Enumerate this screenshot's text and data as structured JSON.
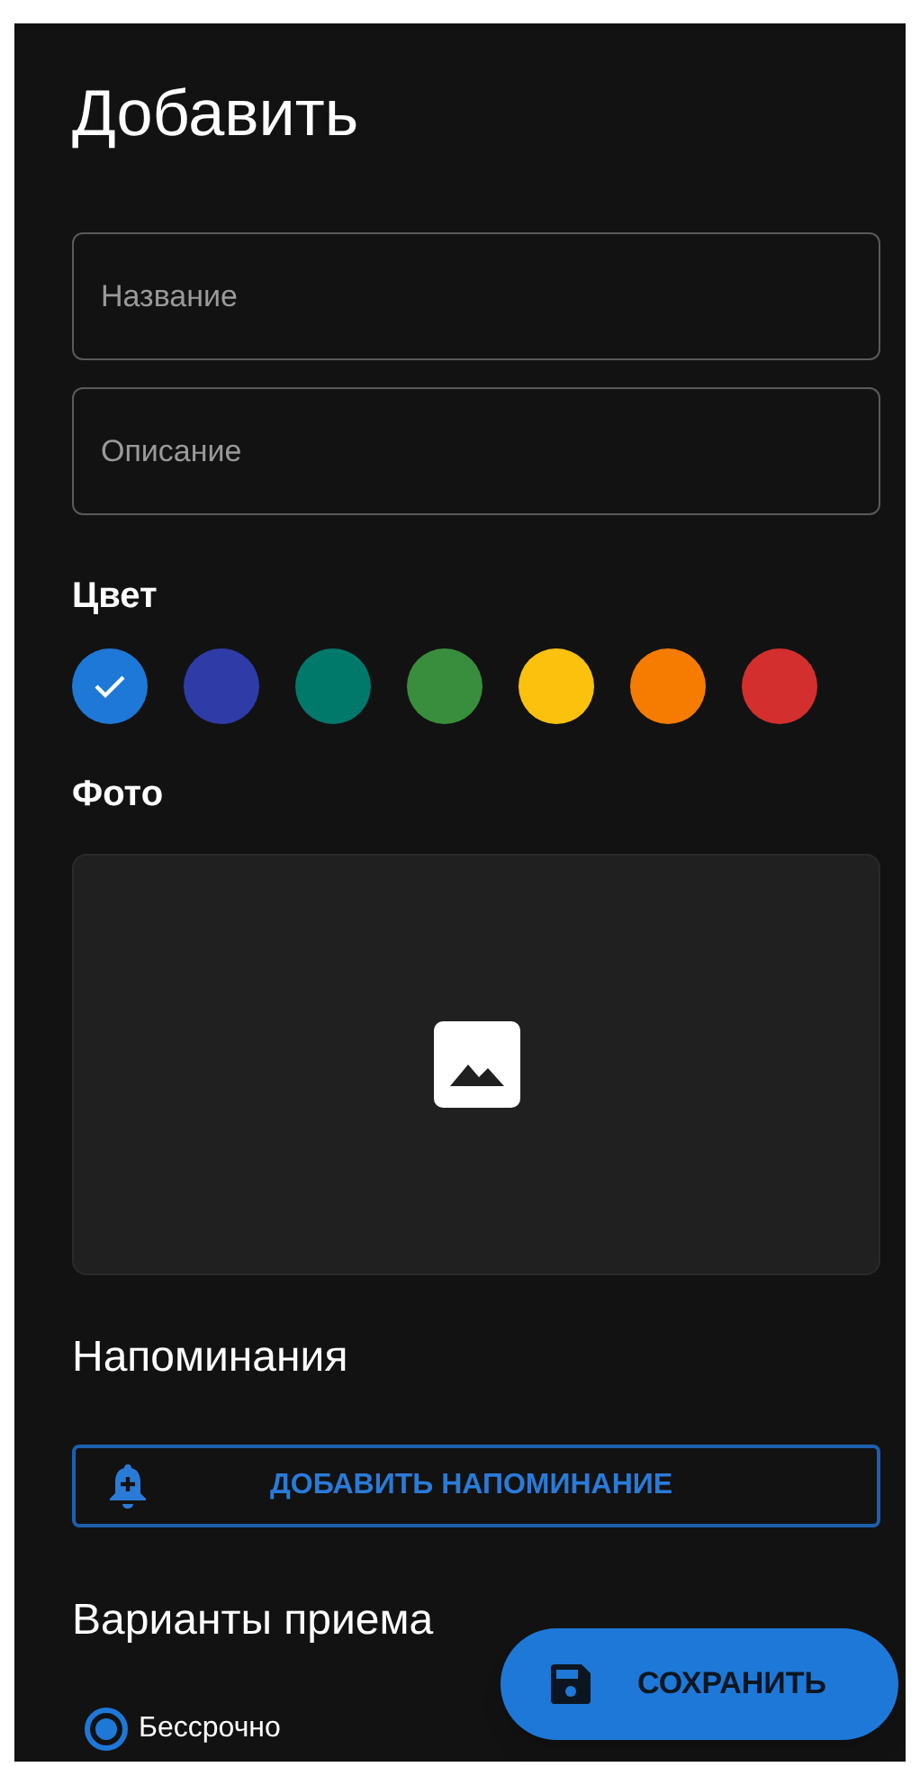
{
  "title": "Добавить",
  "fields": [
    {
      "placeholder": "Название"
    },
    {
      "placeholder": "Описание"
    }
  ],
  "color_section": {
    "label": "Цвет",
    "colors": [
      {
        "color": "#1e78d8",
        "selected": true
      },
      {
        "color": "#2f3ba6",
        "selected": false
      },
      {
        "color": "#00796b",
        "selected": false
      },
      {
        "color": "#388e3c",
        "selected": false
      },
      {
        "color": "#fcc10d",
        "selected": false
      },
      {
        "color": "#f57c00",
        "selected": false
      },
      {
        "color": "#d32f2f",
        "selected": false
      }
    ]
  },
  "photo_section": {
    "label": "Фото"
  },
  "reminders": {
    "label": "Напоминания",
    "add_button": "ДОБАВИТЬ НАПОМИНАНИЕ"
  },
  "intake_options": {
    "label": "Варианты приема",
    "options": [
      {
        "label": "Бессрочно",
        "selected": true
      }
    ]
  },
  "save_button": "СОХРАНИТЬ"
}
